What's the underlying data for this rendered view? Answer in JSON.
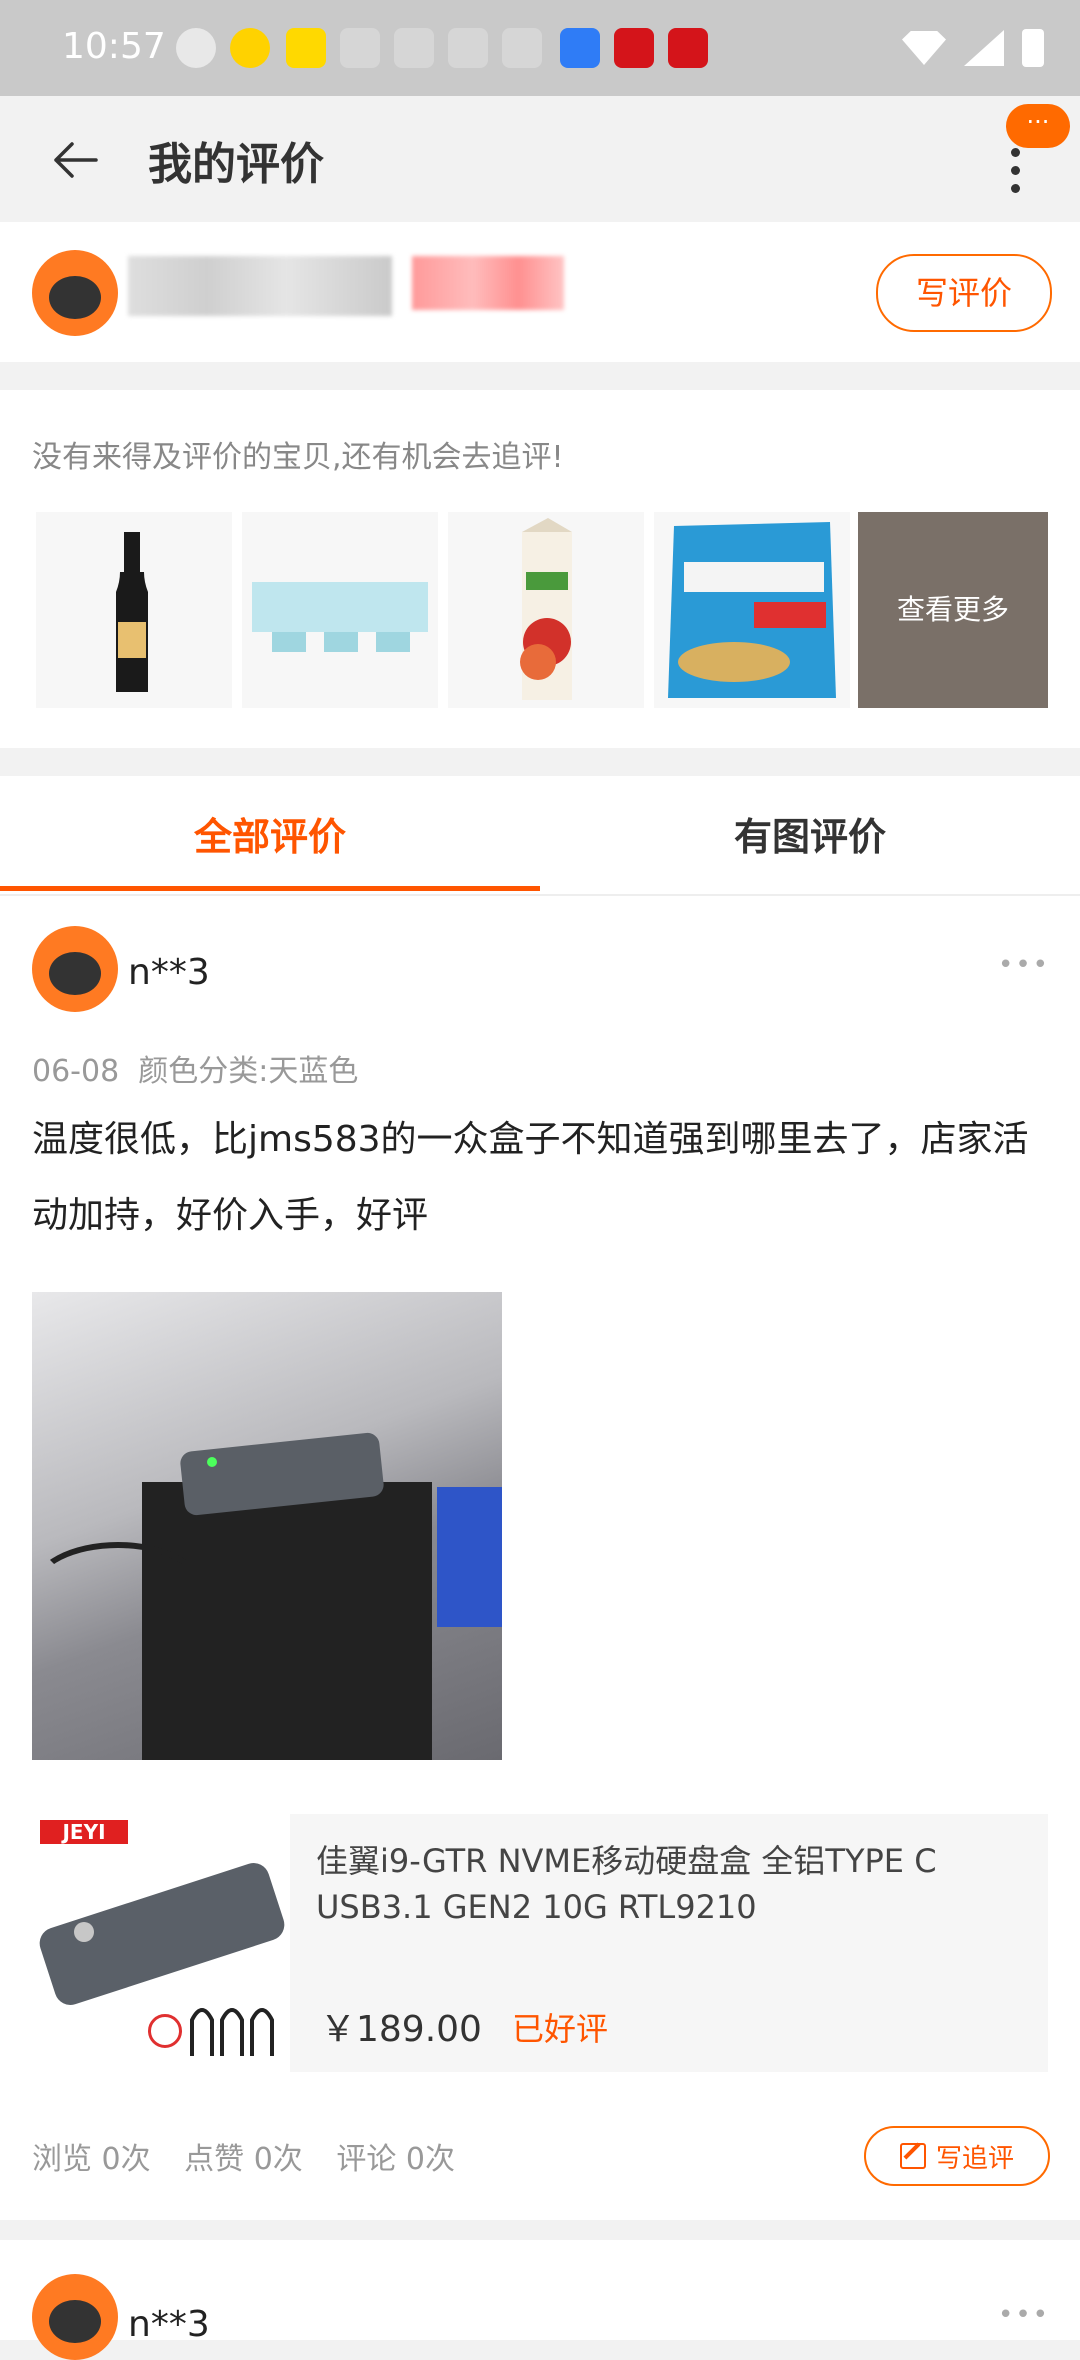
{
  "status_bar": {
    "time": "10:57"
  },
  "header": {
    "title": "我的评价",
    "notification_badge": "···"
  },
  "profile": {
    "write_review_label": "写评价"
  },
  "pending": {
    "prompt": "没有来得及评价的宝贝,还有机会去追评!",
    "items": [
      {
        "icon": "wine-bottle-image"
      },
      {
        "icon": "yogurt-pack-image"
      },
      {
        "icon": "apple-juice-image"
      },
      {
        "icon": "cassava-chips-image"
      }
    ],
    "more_label": "查看更多"
  },
  "tabs": [
    {
      "label": "全部评价",
      "active": true
    },
    {
      "label": "有图评价",
      "active": false
    }
  ],
  "review": {
    "user": "n**3",
    "date": "06-08",
    "spec": "颜色分类:天蓝色",
    "content": "温度很低，比jms583的一众盒子不知道强到哪里去了，店家活动加持，好价入手，好评",
    "product": {
      "brand_badge": "JEYI",
      "title": "佳翼i9-GTR NVME移动硬盘盒 全铝TYPE C USB3.1 GEN2 10G RTL9210",
      "price": "￥189.00",
      "rating_status": "已好评"
    },
    "stats": {
      "views": "浏览 0次",
      "likes": "点赞 0次",
      "comments": "评论 0次"
    },
    "followup_label": "写追评"
  },
  "review2": {
    "user": "n**3"
  },
  "colors": {
    "accent": "#ff5500",
    "status_bar": "#c9c9c9"
  }
}
